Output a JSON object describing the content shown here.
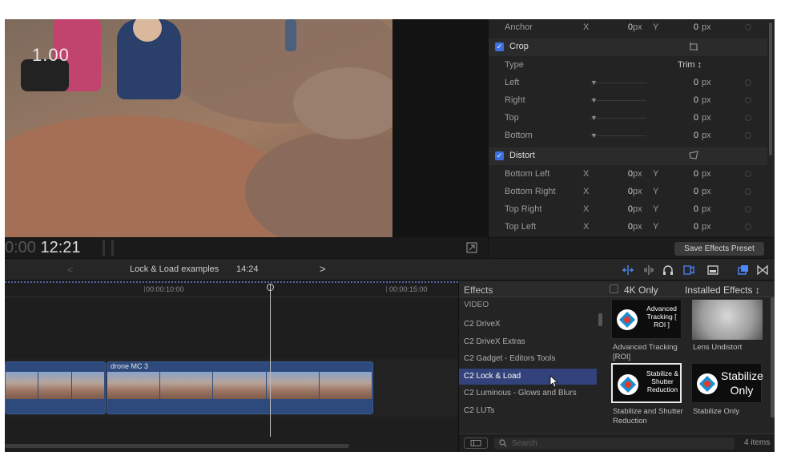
{
  "viewer": {
    "overlay_number": "1.00",
    "timecode_dim": "0:00",
    "timecode": "12:21"
  },
  "inspector": {
    "anchor": {
      "label": "Anchor",
      "x_axis": "X",
      "x_value": "0",
      "x_unit": "px",
      "y_axis": "Y",
      "y_value": "0",
      "y_unit": "px"
    },
    "crop": {
      "title": "Crop",
      "type_label": "Type",
      "type_value": "Trim ↕",
      "rows": [
        {
          "label": "Left",
          "value": "0",
          "unit": "px"
        },
        {
          "label": "Right",
          "value": "0",
          "unit": "px"
        },
        {
          "label": "Top",
          "value": "0",
          "unit": "px"
        },
        {
          "label": "Bottom",
          "value": "0",
          "unit": "px"
        }
      ]
    },
    "distort": {
      "title": "Distort",
      "rows": [
        {
          "label": "Bottom Left",
          "x_axis": "X",
          "x_value": "0",
          "x_unit": "px",
          "y_axis": "Y",
          "y_value": "0",
          "y_unit": "px"
        },
        {
          "label": "Bottom Right",
          "x_axis": "X",
          "x_value": "0",
          "x_unit": "px",
          "y_axis": "Y",
          "y_value": "0",
          "y_unit": "px"
        },
        {
          "label": "Top Right",
          "x_axis": "X",
          "x_value": "0",
          "x_unit": "px",
          "y_axis": "Y",
          "y_value": "0",
          "y_unit": "px"
        },
        {
          "label": "Top Left",
          "x_axis": "X",
          "x_value": "0",
          "x_unit": "px",
          "y_axis": "Y",
          "y_value": "0",
          "y_unit": "px"
        }
      ]
    },
    "save_preset_label": "Save Effects Preset"
  },
  "timeline_toolbar": {
    "back_label": "<",
    "project_name": "Lock & Load examples",
    "project_duration": "14:24",
    "forward_label": ">"
  },
  "timeline": {
    "ruler_labels": [
      "00:00:10:00",
      "00:00:15:00"
    ],
    "clip_name": "drone MC 3"
  },
  "effects": {
    "header": "Effects",
    "filter_4k": "4K Only",
    "installed": "Installed Effects ↕",
    "list": [
      {
        "label": "VIDEO",
        "section": true
      },
      {
        "label": "C2 DriveX"
      },
      {
        "label": "C2 DriveX Extras"
      },
      {
        "label": "C2 Gadget - Editors Tools"
      },
      {
        "label": "C2 Lock & Load",
        "selected": true
      },
      {
        "label": "C2 Luminous - Glows and Blurs"
      },
      {
        "label": "C2 LUTs"
      }
    ],
    "tiles": [
      {
        "thumb_text": "Advanced Tracking [ ROI ]",
        "caption": "Advanced Tracking [ROI]"
      },
      {
        "thumb_text": "",
        "caption": "Lens Undistort"
      },
      {
        "thumb_text": "Stabilize & Shutter Reduction",
        "caption": "Stabilize and Shutter Reduction"
      },
      {
        "thumb_text": "Stabilize Only",
        "caption": "Stabilize Only"
      }
    ],
    "search_placeholder": "Search",
    "item_count": "4 items"
  },
  "colors": {
    "accent_blue": "#3d6fe0",
    "clip_blue": "#2e4a7d",
    "selection": "#33427a",
    "panel_bg": "#1e1e1e"
  }
}
